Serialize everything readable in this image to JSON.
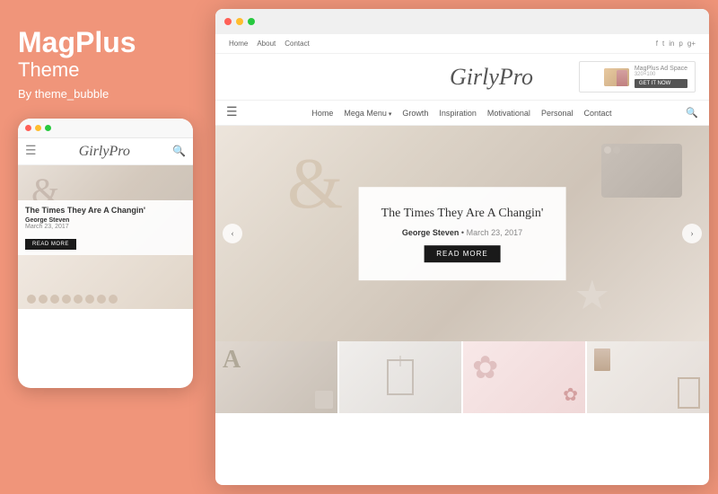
{
  "brand": {
    "title": "MagPlus",
    "subtitle": "Theme",
    "by": "By theme_bubble"
  },
  "mobile": {
    "logo": "GirlyPro",
    "article_title": "The Times They Are A Changin'",
    "author": "George Steven",
    "date": "March 23, 2017",
    "read_more": "READ MORE"
  },
  "desktop": {
    "top_nav": {
      "links": [
        "Home",
        "About",
        "Contact"
      ],
      "social_icons": [
        "f",
        "t",
        "in",
        "p",
        "g+"
      ]
    },
    "logo": "GirlyPro",
    "ad": {
      "label": "MagPlus Ad Space",
      "size": "320×100",
      "button": "GET IT NOW"
    },
    "main_nav": {
      "links": [
        "Home",
        "Mega Menu",
        "Growth",
        "Inspiration",
        "Motivational",
        "Personal",
        "Contact"
      ]
    },
    "hero": {
      "title": "The Times They Are A Changin'",
      "author": "George Steven",
      "date_prefix": "•",
      "date": "March 23, 2017",
      "read_more": "READ MORE"
    }
  }
}
